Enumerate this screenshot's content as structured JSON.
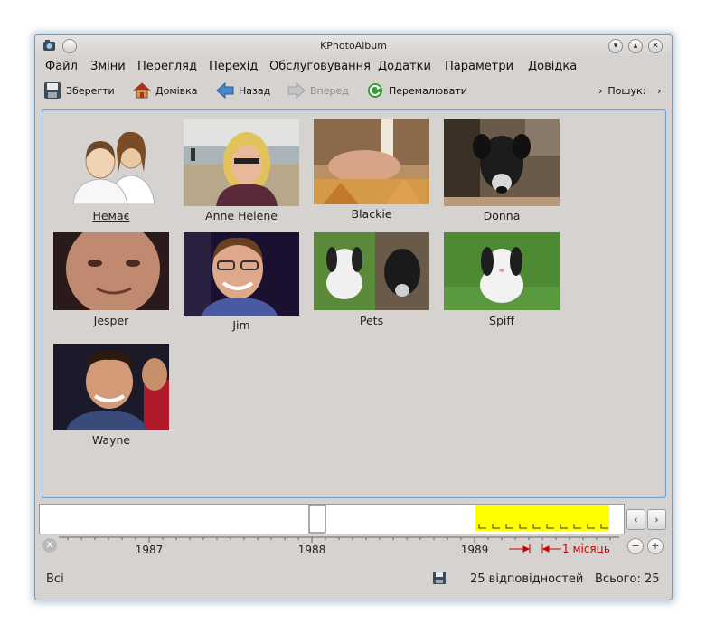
{
  "window": {
    "title": "KPhotoAlbum"
  },
  "menubar": [
    {
      "label": "Файл"
    },
    {
      "label": "Зміни"
    },
    {
      "label": "Перегляд"
    },
    {
      "label": "Перехід"
    },
    {
      "label": "Обслуговування"
    },
    {
      "label": "Додатки"
    },
    {
      "label": "Параметри"
    },
    {
      "label": "Довідка"
    }
  ],
  "toolbar": {
    "save": "Зберегти",
    "home": "Домівка",
    "back": "Назад",
    "forward": "Вперед",
    "redraw": "Перемалювати",
    "search_label": "Пошук:"
  },
  "people": [
    {
      "name": "Немає"
    },
    {
      "name": "Anne Helene"
    },
    {
      "name": "Blackie"
    },
    {
      "name": "Donna"
    },
    {
      "name": "Jesper"
    },
    {
      "name": "Jim"
    },
    {
      "name": "Pets"
    },
    {
      "name": "Spiff"
    },
    {
      "name": "Wayne"
    }
  ],
  "timeline": {
    "years": [
      "1987",
      "1988",
      "1989"
    ],
    "unit_label": "1 місяць",
    "highlight_color": "#ffff00",
    "unit_color": "#cc0000"
  },
  "status": {
    "scope": "Всі",
    "matches": "25 відповідностей",
    "total": "Всього: 25"
  }
}
